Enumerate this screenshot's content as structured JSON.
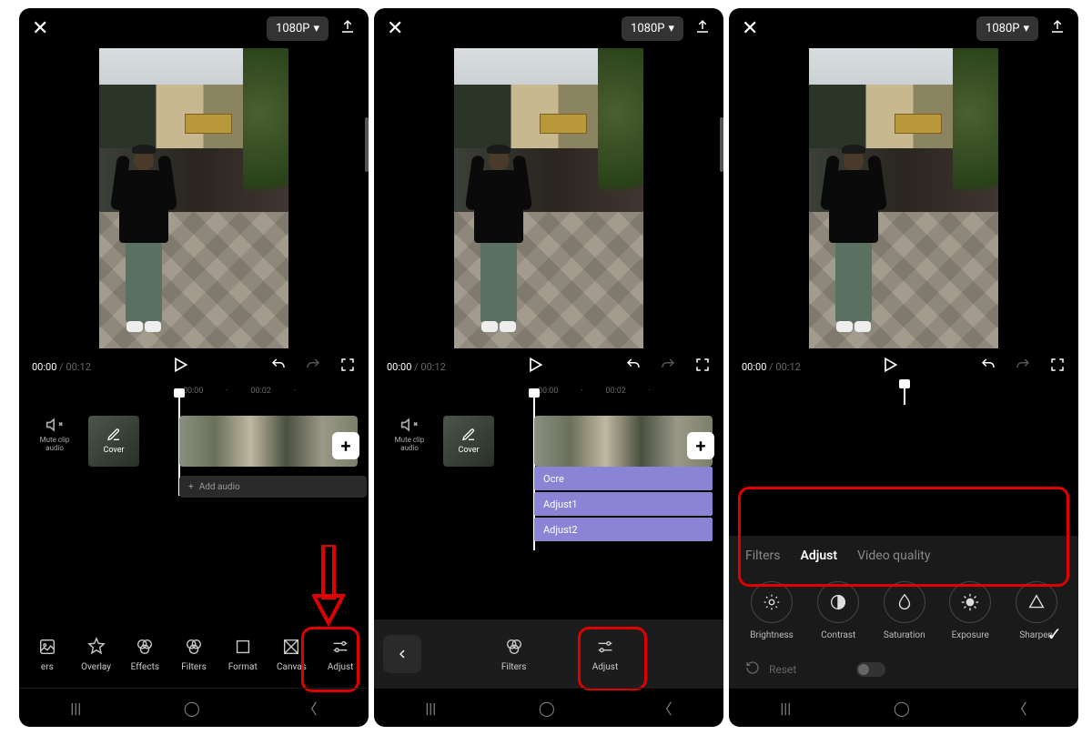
{
  "header": {
    "resolution": "1080P"
  },
  "time": {
    "current": "00:00",
    "duration": "00:12"
  },
  "timeline": {
    "tick1": "00:00",
    "tick2": "00:02",
    "mute_label": "Mute clip audio",
    "cover_label": "Cover",
    "add_audio": "Add audio",
    "tracks": [
      "Ocre",
      "Adjust1",
      "Adjust2"
    ]
  },
  "toolbar1": {
    "items": [
      "ers",
      "Overlay",
      "Effects",
      "Filters",
      "Format",
      "Canvas",
      "Adjust"
    ]
  },
  "toolbar2": {
    "items": [
      "Filters",
      "Adjust"
    ]
  },
  "adjust": {
    "tabs": [
      "Filters",
      "Adjust",
      "Video quality"
    ],
    "active": "Adjust",
    "items": [
      "Brightness",
      "Contrast",
      "Saturation",
      "Exposure",
      "Sharpen"
    ],
    "reset": "Reset"
  }
}
